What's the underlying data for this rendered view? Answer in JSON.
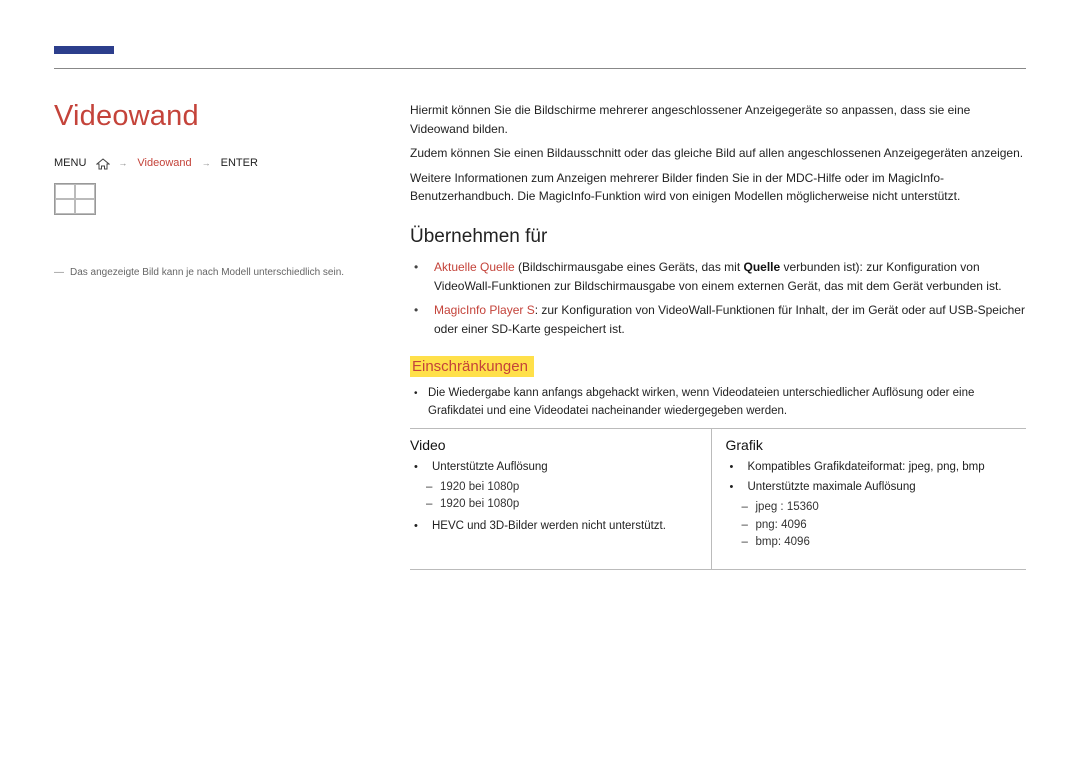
{
  "title": "Videowand",
  "breadcrumb": {
    "left": "MENU",
    "active": "Videowand",
    "right": "ENTER"
  },
  "left_note": "Das angezeigte Bild kann je nach Modell unterschiedlich sein.",
  "intro": {
    "p1": "Hiermit können Sie die Bildschirme mehrerer angeschlossener Anzeigegeräte so anpassen, dass sie eine Videowand bilden.",
    "p2": "Zudem können Sie einen Bildausschnitt oder das gleiche Bild auf allen angeschlossenen Anzeigegeräten anzeigen.",
    "p3": "Weitere Informationen zum Anzeigen mehrerer Bilder finden Sie in der MDC-Hilfe oder im MagicInfo-Benutzerhandbuch. Die MagicInfo-Funktion wird von einigen Modellen möglicherweise nicht unterstützt."
  },
  "apply_to": {
    "heading": "Übernehmen für",
    "items": [
      {
        "term": "Aktuelle Quelle",
        "rest_a": " (Bildschirmausgabe eines Geräts, das mit ",
        "bold": "Quelle",
        "rest_b": " verbunden ist): zur Konfiguration von VideoWall-Funktionen zur Bildschirmausgabe von einem externen Gerät, das mit dem Gerät verbunden ist."
      },
      {
        "term": "MagicInfo Player S",
        "rest_a": ": zur Konfiguration von VideoWall-Funktionen für Inhalt, der im Gerät oder auf USB-Speicher oder einer SD-Karte gespeichert ist.",
        "bold": "",
        "rest_b": ""
      }
    ]
  },
  "restrictions": {
    "heading": "Einschränkungen",
    "note": "Die Wiedergabe kann anfangs abgehackt wirken, wenn Videodateien unterschiedlicher Auflösung oder eine Grafikdatei und eine Videodatei nacheinander wiedergegeben werden."
  },
  "table": {
    "video": {
      "heading": "Video",
      "b1": "Unterstützte Auflösung",
      "sub": [
        "1920 bei 1080p",
        "1920 bei 1080p"
      ],
      "b2": "HEVC und 3D-Bilder werden nicht unterstützt."
    },
    "grafik": {
      "heading": "Grafik",
      "b1": "Kompatibles Grafikdateiformat: jpeg, png, bmp",
      "b2": "Unterstützte maximale Auflösung",
      "sub": [
        "jpeg : 15360",
        "png: 4096",
        "bmp: 4096"
      ]
    }
  }
}
